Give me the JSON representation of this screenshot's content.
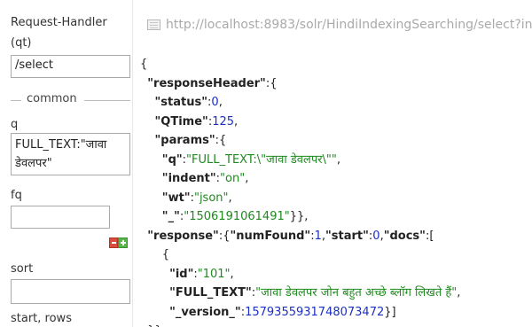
{
  "query_form": {
    "request_handler_label_line1": "Request-Handler",
    "request_handler_label_line2": "(qt)",
    "request_handler_value": "/select",
    "common_section_label": "common",
    "q_label": "q",
    "q_value_line1": "FULL_TEXT:\"जावा",
    "q_value_line2": "डेवलपर\"",
    "fq_label": "fq",
    "fq_value": "",
    "sort_label": "sort",
    "sort_value": "",
    "start_rows_label": "start, rows"
  },
  "response": {
    "url": "http://localhost:8983/solr/HindiIndexingSearching/select?ind",
    "json": {
      "open_brace": "{",
      "responseHeader_key": "\"responseHeader\"",
      "status_key": "\"status\"",
      "status_value": "0",
      "qtime_key": "\"QTime\"",
      "qtime_value": "125",
      "params_key": "\"params\"",
      "q_key": "\"q\"",
      "q_value": "\"FULL_TEXT:\\\"जावा डेवलपर\\\"\"",
      "indent_key": "\"indent\"",
      "indent_value": "\"on\"",
      "wt_key": "\"wt\"",
      "wt_value": "\"json\"",
      "underscore_key": "\"_\"",
      "underscore_value": "\"1506191061491\"",
      "response_key": "\"response\"",
      "numfound_key": "\"numFound\"",
      "numfound_value": "1",
      "start_key": "\"start\"",
      "start_value": "0",
      "docs_key": "\"docs\"",
      "id_key": "\"id\"",
      "id_value": "\"101\"",
      "full_text_key": "\"FULL_TEXT\"",
      "full_text_value": "\"जावा डेवलपर जोन बहुत अच्छे ब्लॉग लिखते हैं\"",
      "version_key": "\"_version_\"",
      "version_value": "1579355931748073472"
    }
  },
  "colors": {
    "json_string": "#1e8a1e",
    "json_number": "#1b2fc2",
    "remove_button": "#d94b3a",
    "add_button": "#58b548"
  },
  "icons": [
    "page-icon",
    "remove-filter-icon",
    "add-filter-icon"
  ]
}
